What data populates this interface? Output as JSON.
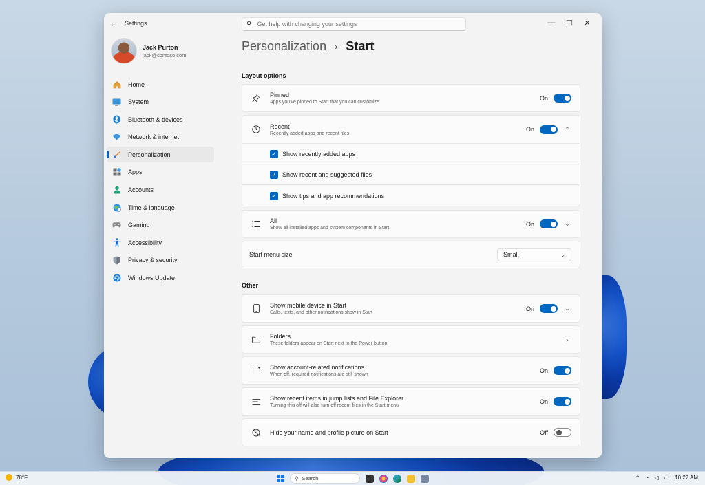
{
  "window": {
    "app_title": "Settings",
    "search_placeholder": "Get help with changing your settings"
  },
  "profile": {
    "name": "Jack Purton",
    "email": "jack@contoso.com"
  },
  "nav": [
    {
      "label": "Home",
      "icon": "home-icon"
    },
    {
      "label": "System",
      "icon": "monitor-icon"
    },
    {
      "label": "Bluetooth & devices",
      "icon": "bluetooth-icon"
    },
    {
      "label": "Network & internet",
      "icon": "wifi-icon"
    },
    {
      "label": "Personalization",
      "icon": "brush-icon",
      "active": true
    },
    {
      "label": "Apps",
      "icon": "apps-icon"
    },
    {
      "label": "Accounts",
      "icon": "person-icon"
    },
    {
      "label": "Time & language",
      "icon": "globe-clock-icon"
    },
    {
      "label": "Gaming",
      "icon": "controller-icon"
    },
    {
      "label": "Accessibility",
      "icon": "accessibility-icon"
    },
    {
      "label": "Privacy & security",
      "icon": "shield-icon"
    },
    {
      "label": "Windows Update",
      "icon": "update-icon"
    }
  ],
  "header": {
    "parent": "Personalization",
    "separator": "›",
    "current": "Start"
  },
  "layout_options": {
    "label": "Layout options",
    "pinned": {
      "title": "Pinned",
      "subtitle": "Apps you've pinned to Start that you can customize",
      "state": "On"
    },
    "recent": {
      "title": "Recent",
      "subtitle": "Recently added apps and recent files",
      "state": "On"
    },
    "checks": [
      "Show recently added apps",
      "Show recent and suggested files",
      "Show tips and app recommendations"
    ],
    "all": {
      "title": "All",
      "subtitle": "Show all installed apps and system components in Start",
      "state": "On"
    },
    "menu_size": {
      "title": "Start menu size",
      "value": "Small"
    }
  },
  "other": {
    "label": "Other",
    "mobile": {
      "title": "Show mobile device in Start",
      "subtitle": "Calls, texts, and other notifications show in Start",
      "state": "On"
    },
    "folders": {
      "title": "Folders",
      "subtitle": "These folders appear on Start next to the Power button"
    },
    "account_notifs": {
      "title": "Show account-related notifications",
      "subtitle": "When off, required notifications are still shown",
      "state": "On"
    },
    "jump_lists": {
      "title": "Show recent items in jump lists and File Explorer",
      "subtitle": "Turning this off will also turn off recent files in the Start menu",
      "state": "On"
    },
    "hide_name": {
      "title": "Hide your name and profile picture on Start",
      "state": "Off"
    }
  },
  "taskbar": {
    "weather": "78°F",
    "search": "Search",
    "time": "10:27 AM"
  },
  "colors": {
    "accent": "#0067c0",
    "window_bg": "#f3f3f3",
    "card_bg": "#fbfbfb"
  }
}
